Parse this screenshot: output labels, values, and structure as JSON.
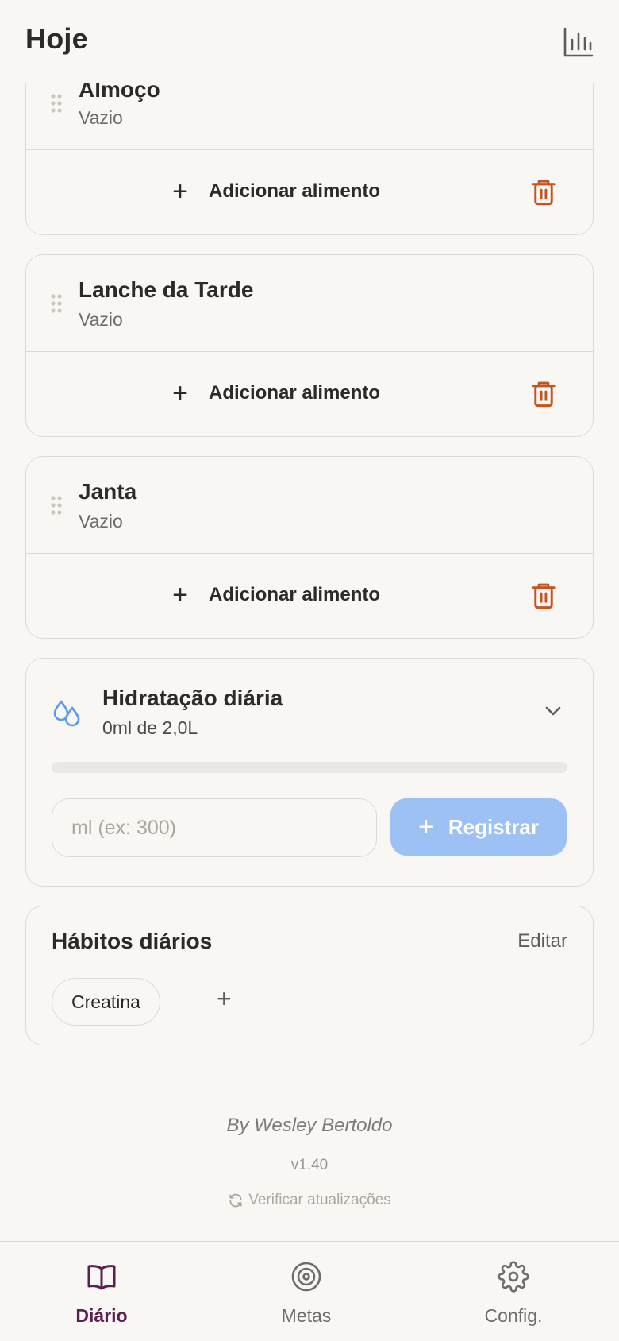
{
  "header": {
    "title": "Hoje",
    "chart_icon": "bar-chart-icon"
  },
  "meals": [
    {
      "name": "Almoço",
      "status": "Vazio",
      "add_label": "Adicionar alimento"
    },
    {
      "name": "Lanche da Tarde",
      "status": "Vazio",
      "add_label": "Adicionar alimento"
    },
    {
      "name": "Janta",
      "status": "Vazio",
      "add_label": "Adicionar alimento"
    }
  ],
  "hydration": {
    "title": "Hidratação diária",
    "summary": "0ml de 2,0L",
    "progress_fraction": 0,
    "input_placeholder": "ml (ex: 300)",
    "register_label": "Registrar"
  },
  "habits": {
    "title": "Hábitos diários",
    "edit_label": "Editar",
    "chips": [
      "Creatina"
    ]
  },
  "footer": {
    "author": "By Wesley Bertoldo",
    "version": "v1.40",
    "update_label": "Verificar atualizações"
  },
  "nav": {
    "items": [
      {
        "label": "Diário",
        "icon": "book-icon",
        "active": true
      },
      {
        "label": "Metas",
        "icon": "target-icon",
        "active": false
      },
      {
        "label": "Config.",
        "icon": "gear-icon",
        "active": false
      }
    ]
  },
  "colors": {
    "accent": "#5c1f4f",
    "danger": "#c4531e",
    "water": "#5b9ce8",
    "register_button": "#9dc1f5",
    "background": "#f8f7f4",
    "border": "#dcdad6"
  }
}
